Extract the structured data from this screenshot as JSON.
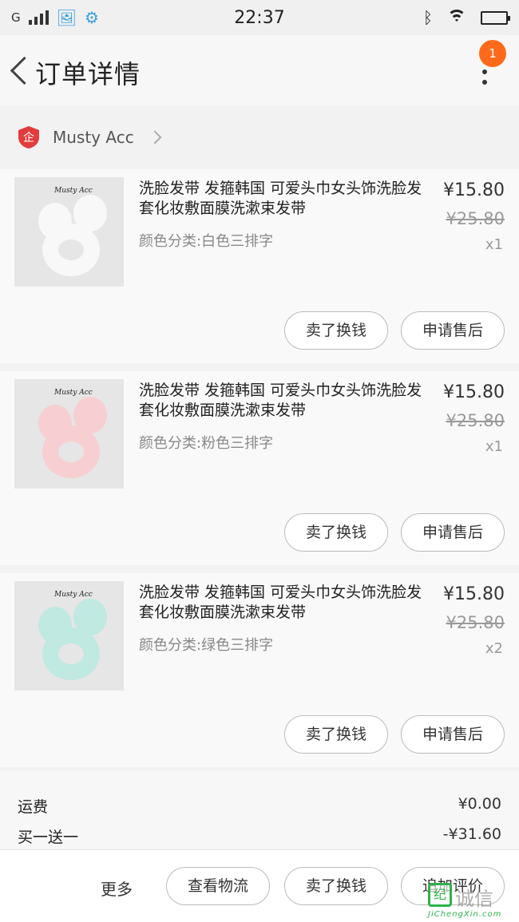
{
  "status_bar": {
    "carrier": "G",
    "time": "22:37"
  },
  "header": {
    "title": "订单详情",
    "notification_count": "1"
  },
  "shop": {
    "name": "Musty Acc",
    "logo_glyph": "企"
  },
  "items": [
    {
      "title": "洗脸发带 发箍韩国 可爱头巾女头饰洗脸发套化妆敷面膜洗漱束发带",
      "variant": "颜色分类:白色三排字",
      "price": "¥15.80",
      "original_price": "¥25.80",
      "quantity": "x1",
      "thumb_brand": "Musty Acc",
      "band_color": "#f8f8f8",
      "sell_label": "卖了换钱",
      "after_sale_label": "申请售后"
    },
    {
      "title": "洗脸发带 发箍韩国 可爱头巾女头饰洗脸发套化妆敷面膜洗漱束发带",
      "variant": "颜色分类:粉色三排字",
      "price": "¥15.80",
      "original_price": "¥25.80",
      "quantity": "x1",
      "thumb_brand": "Musty Acc",
      "band_color": "#f7cfd2",
      "sell_label": "卖了换钱",
      "after_sale_label": "申请售后"
    },
    {
      "title": "洗脸发带 发箍韩国 可爱头巾女头饰洗脸发套化妆敷面膜洗漱束发带",
      "variant": "颜色分类:绿色三排字",
      "price": "¥15.80",
      "original_price": "¥25.80",
      "quantity": "x2",
      "thumb_brand": "Musty Acc",
      "band_color": "#bfe9e1",
      "sell_label": "卖了换钱",
      "after_sale_label": "申请售后"
    }
  ],
  "summary": {
    "shipping_label": "运费",
    "shipping_value": "¥0.00",
    "promo_label": "买一送一",
    "promo_value": "-¥31.60"
  },
  "bottom_bar": {
    "more": "更多",
    "logistics": "查看物流",
    "sell": "卖了换钱",
    "review": "追加评价"
  },
  "watermark": {
    "cn": "诚信",
    "url": "JiChengXin.com"
  },
  "colors": {
    "accent": "#ff6a1a",
    "shop_logo": "#e23c3c",
    "watermark": "#2db34a"
  }
}
